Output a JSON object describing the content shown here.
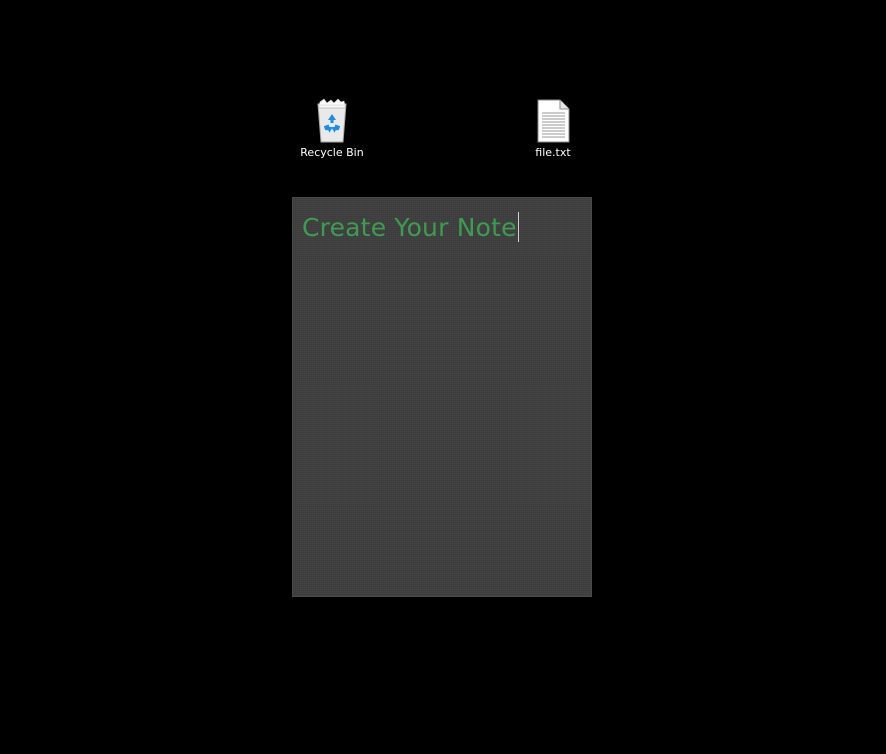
{
  "desktop": {
    "icons": [
      {
        "label": "Recycle Bin",
        "icon": "recycle-bin-icon"
      },
      {
        "label": "file.txt",
        "icon": "text-file-icon"
      }
    ]
  },
  "note": {
    "text": "Create Your Note",
    "text_color": "#3f9a52",
    "panel_color": "#3f3f3f"
  }
}
